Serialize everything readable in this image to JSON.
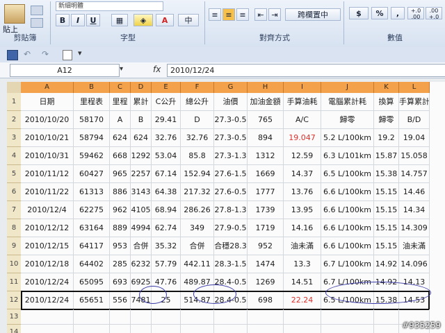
{
  "ribbon": {
    "clipboard": {
      "paste_label": "貼上",
      "group_label": "剪貼簿"
    },
    "font": {
      "font_name": "新細明體",
      "bold": "B",
      "italic": "I",
      "underline": "U",
      "font_color_letter": "A",
      "group_label": "字型",
      "phonetic_label": "中"
    },
    "alignment": {
      "merge_label": "跨欄置中",
      "group_label": "對齊方式"
    },
    "number": {
      "currency": "$",
      "percent": "%",
      "comma": ",",
      "inc_decimal": "+.0 .00",
      "dec_decimal": ".00 +.0",
      "group_label": "數值"
    }
  },
  "formula_bar": {
    "name_box": "A12",
    "fx": "fx",
    "value": "2010/12/24"
  },
  "columns": [
    "A",
    "B",
    "C",
    "D",
    "E",
    "F",
    "G",
    "H",
    "I",
    "J",
    "K",
    "L"
  ],
  "rows": [
    {
      "n": "1",
      "cells": [
        "日期",
        "里程表",
        "里程",
        "累計",
        "C公升",
        "總公升",
        "油價",
        "加油金額",
        "手算油耗",
        "電腦累計耗",
        "換算",
        "手算累計"
      ]
    },
    {
      "n": "2",
      "cells": [
        "2010/10/20",
        "58170",
        "A",
        "B",
        "29.41",
        "D",
        "27.3-0.5",
        "765",
        "A/C",
        "歸零",
        "歸零",
        "B/D"
      ]
    },
    {
      "n": "3",
      "cells": [
        "2010/10/21",
        "58794",
        "624",
        "624",
        "32.76",
        "32.76",
        "27.3-0.5",
        "894",
        "19.047",
        "5.2 L/100km",
        "19.2",
        "19.04"
      ]
    },
    {
      "n": "4",
      "cells": [
        "2010/10/31",
        "59462",
        "668",
        "1292",
        "53.04",
        "85.8",
        "27.3-1.3",
        "1312",
        "12.59",
        "6.3 L/101km",
        "15.87",
        "15.058"
      ]
    },
    {
      "n": "5",
      "cells": [
        "2010/11/12",
        "60427",
        "965",
        "2257",
        "67.14",
        "152.94",
        "27.6-1.5",
        "1669",
        "14.37",
        "6.5 L/100km",
        "15.38",
        "14.757"
      ]
    },
    {
      "n": "6",
      "cells": [
        "2010/11/22",
        "61313",
        "886",
        "3143",
        "64.38",
        "217.32",
        "27.6-0.5",
        "1777",
        "13.76",
        "6.6 L/100km",
        "15.15",
        "14.46"
      ]
    },
    {
      "n": "7",
      "cells": [
        "2010/12/4",
        "62275",
        "962",
        "4105",
        "68.94",
        "286.26",
        "27.8-1.3",
        "1739",
        "13.95",
        "6.6 L/100km",
        "15.15",
        "14.34"
      ]
    },
    {
      "n": "8",
      "cells": [
        "2010/12/12",
        "63164",
        "889",
        "4994",
        "62.74",
        "349",
        "27.9-0.5",
        "1719",
        "14.16",
        "6.6 L/100km",
        "15.15",
        "14.309"
      ]
    },
    {
      "n": "9",
      "cells": [
        "2010/12/15",
        "64117",
        "953",
        "合併",
        "35.32",
        "合併",
        "合穩28.3",
        "952",
        "油未滿",
        "6.6 L/100km",
        "15.15",
        "油未滿"
      ]
    },
    {
      "n": "10",
      "cells": [
        "2010/12/18",
        "64402",
        "285",
        "6232",
        "57.79",
        "442.11",
        "28.3-1.5",
        "1474",
        "13.3",
        "6.7 L/100km",
        "14.92",
        "14.096"
      ]
    },
    {
      "n": "11",
      "cells": [
        "2010/12/24",
        "65095",
        "693",
        "6925",
        "47.76",
        "489.87",
        "28.4-0.5",
        "1269",
        "14.51",
        "6.7 L/100km",
        "14.92",
        "14.13"
      ]
    },
    {
      "n": "12",
      "cells": [
        "2010/12/24",
        "65651",
        "556",
        "7481",
        "25",
        "514.87",
        "28.4-0.5",
        "698",
        "22.24",
        "6.5 L/100km",
        "15.38",
        "14.53"
      ]
    },
    {
      "n": "13",
      "cells": [
        "",
        "",
        "",
        "",
        "",
        "",
        "",
        "",
        "",
        "",
        "",
        ""
      ]
    },
    {
      "n": "14",
      "cells": [
        "",
        "",
        "",
        "",
        "",
        "",
        "",
        "",
        "",
        "",
        "",
        ""
      ]
    }
  ],
  "watermark": "#935259",
  "colors": {
    "header_orange": "#f3a24b",
    "red_value": "#e0302c",
    "circle_blue": "#3b3ba8"
  }
}
